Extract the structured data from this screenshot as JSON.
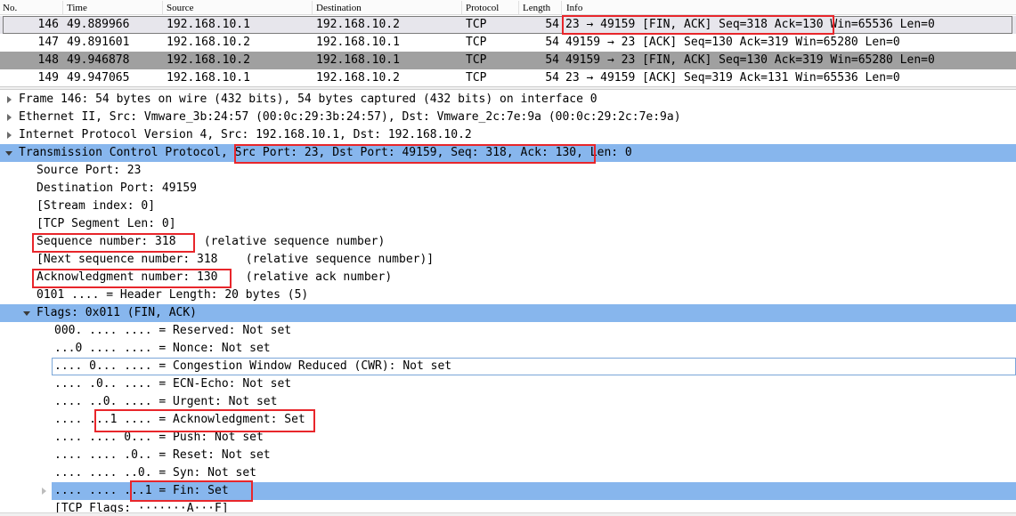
{
  "packet_list": {
    "columns": [
      "No.",
      "Time",
      "Source",
      "Destination",
      "Protocol",
      "Length",
      "Info"
    ],
    "rows": [
      {
        "no": "146",
        "time": "49.889966",
        "source": "192.168.10.1",
        "destination": "192.168.10.2",
        "protocol": "TCP",
        "length": "54",
        "info": "23 → 49159 [FIN, ACK] Seq=318 Ack=130 Win=65536 Len=0"
      },
      {
        "no": "147",
        "time": "49.891601",
        "source": "192.168.10.2",
        "destination": "192.168.10.1",
        "protocol": "TCP",
        "length": "54",
        "info": "49159 → 23 [ACK] Seq=130 Ack=319 Win=65280 Len=0"
      },
      {
        "no": "148",
        "time": "49.946878",
        "source": "192.168.10.2",
        "destination": "192.168.10.1",
        "protocol": "TCP",
        "length": "54",
        "info": "49159 → 23 [FIN, ACK] Seq=130 Ack=319 Win=65280 Len=0"
      },
      {
        "no": "149",
        "time": "49.947065",
        "source": "192.168.10.1",
        "destination": "192.168.10.2",
        "protocol": "TCP",
        "length": "54",
        "info": "23 → 49159 [ACK] Seq=319 Ack=131 Win=65536 Len=0"
      }
    ]
  },
  "details": {
    "frame": "Frame 146: 54 bytes on wire (432 bits), 54 bytes captured (432 bits) on interface 0",
    "ethernet": "Ethernet II, Src: Vmware_3b:24:57 (00:0c:29:3b:24:57), Dst: Vmware_2c:7e:9a (00:0c:29:2c:7e:9a)",
    "ip": "Internet Protocol Version 4, Src: 192.168.10.1, Dst: 192.168.10.2",
    "tcp": "Transmission Control Protocol, Src Port: 23, Dst Port: 49159, Seq: 318, Ack: 130, Len: 0",
    "source_port": "Source Port: 23",
    "destination_port": "Destination Port: 49159",
    "stream_index": "[Stream index: 0]",
    "segment_len": "[TCP Segment Len: 0]",
    "sequence_number": "Sequence number: 318    (relative sequence number)",
    "next_sequence_number": "[Next sequence number: 318    (relative sequence number)]",
    "ack_number": "Acknowledgment number: 130    (relative ack number)",
    "header_length": "0101 .... = Header Length: 20 bytes (5)",
    "flags": "Flags: 0x011 (FIN, ACK)",
    "flag_lines": [
      "000. .... .... = Reserved: Not set",
      "...0 .... .... = Nonce: Not set",
      ".... 0... .... = Congestion Window Reduced (CWR): Not set",
      ".... .0.. .... = ECN-Echo: Not set",
      ".... ..0. .... = Urgent: Not set",
      ".... ...1 .... = Acknowledgment: Set",
      ".... .... 0... = Push: Not set",
      ".... .... .0.. = Reset: Not set",
      ".... .... ..0. = Syn: Not set",
      ".... .... ...1 = Fin: Set"
    ],
    "tcp_flags": "[TCP Flags: ·······A···F]"
  },
  "colors": {
    "selected_blue": "#87b6ed",
    "annotation_red": "#e8262b",
    "row_dark": "#a0a0a0",
    "row_light": "#e7e6ec"
  }
}
